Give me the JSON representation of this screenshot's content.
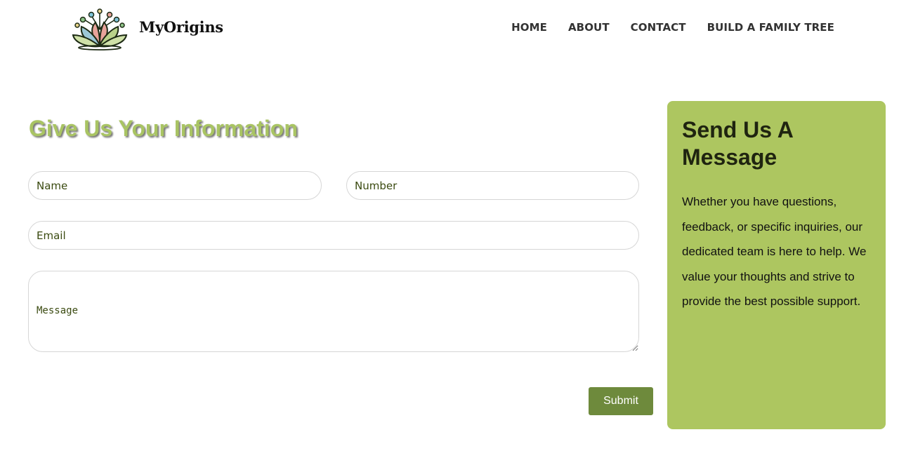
{
  "header": {
    "brand": "MyOrigins",
    "logo_icon": "lotus-family-tree-logo-icon",
    "nav": [
      {
        "label": "HOME"
      },
      {
        "label": "ABOUT"
      },
      {
        "label": "CONTACT"
      },
      {
        "label": "BUILD A FAMILY TREE"
      }
    ]
  },
  "form": {
    "title": "Give Us Your Information",
    "name_placeholder": "Name",
    "number_placeholder": "Number",
    "email_placeholder": "Email",
    "message_placeholder": "Message",
    "submit_label": "Submit"
  },
  "panel": {
    "title": "Send Us A Message",
    "text": "Whether you have questions, feedback, or specific inquiries, our dedicated team is here to help. We value your thoughts and strive to provide the best possible support."
  },
  "colors": {
    "accent_green": "#adc660",
    "button_green": "#6e8a3c",
    "title_green": "#a9c463"
  }
}
